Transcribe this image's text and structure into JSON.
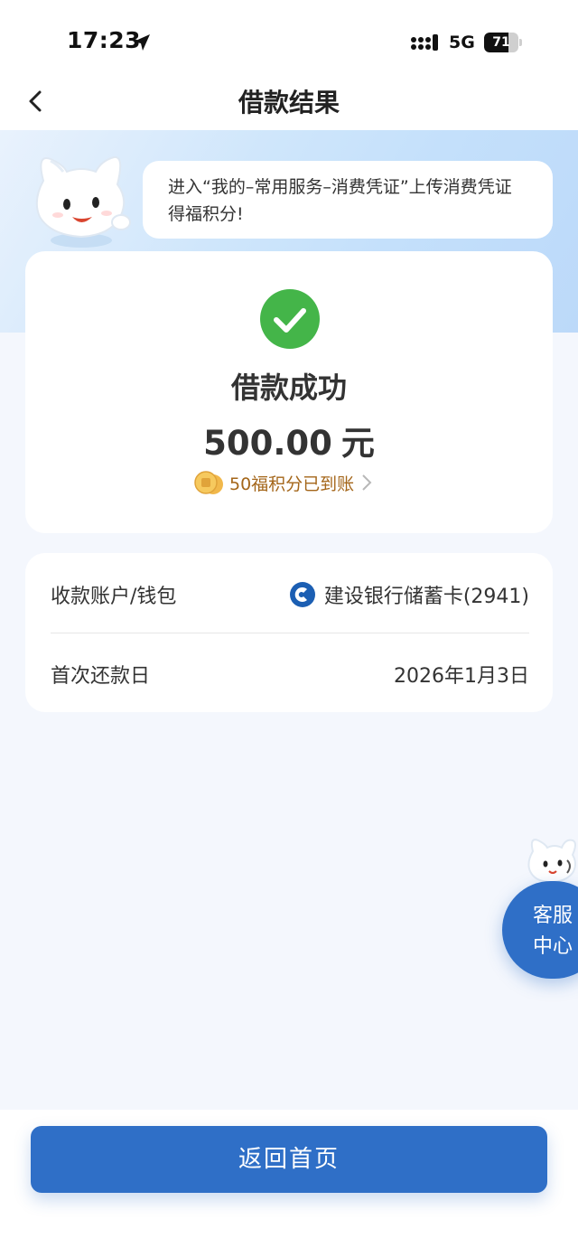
{
  "status_bar": {
    "time": "17:23",
    "network": "5G",
    "battery_level": 71,
    "battery_text": "71"
  },
  "nav": {
    "title": "借款结果",
    "back_icon": "chevron-left-icon"
  },
  "banner": {
    "text": "进入“我的–常用服务–消费凭证”上传消费凭证得福积分!"
  },
  "result": {
    "title": "借款成功",
    "amount": "500.00",
    "unit": "元",
    "points_text": "50福积分已到账",
    "success_color": "#44b549"
  },
  "info": {
    "account_label": "收款账户/钱包",
    "account_value": "建设银行储蓄卡(2941)",
    "repay_label": "首次还款日",
    "repay_value": "2026年1月3日"
  },
  "service": {
    "label": "客服中心"
  },
  "footer": {
    "home_button": "返回首页"
  },
  "colors": {
    "accent": "#2f6fc7",
    "bank_brand": "#1c5fb3"
  }
}
